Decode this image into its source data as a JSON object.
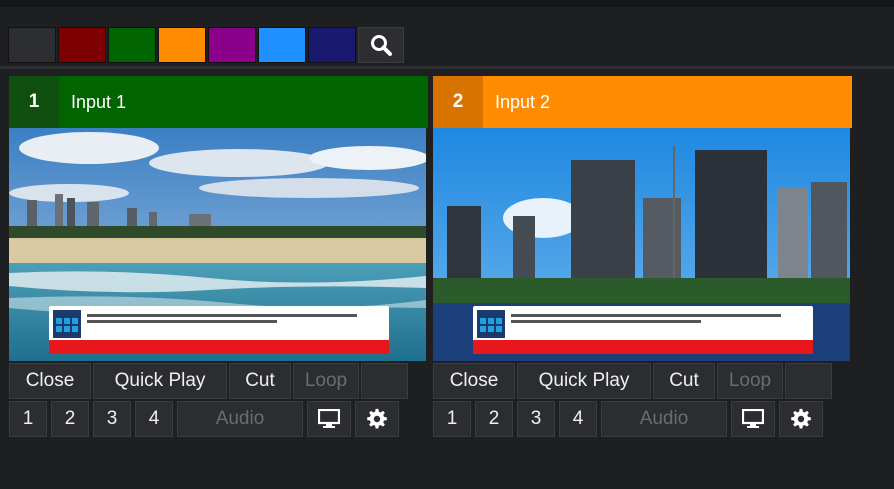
{
  "colors": {
    "swatch_dark": "#2c2e31",
    "swatch_red": "#7f0000",
    "swatch_green": "#006400",
    "swatch_orange": "#ff8c00",
    "swatch_purple": "#8b008b",
    "swatch_blue": "#1e90ff",
    "swatch_navy": "#191970",
    "input1_header": "#006400",
    "input1_number_bg": "#0f4f0f",
    "input2_header": "#ff8c00",
    "input2_number_bg": "#d97300"
  },
  "toolbar": {
    "swatches": [
      "#2c2e31",
      "#7f0000",
      "#006400",
      "#ff8c00",
      "#8b008b",
      "#1e90ff",
      "#191970"
    ],
    "search_icon": "search-icon"
  },
  "inputs": [
    {
      "number": "1",
      "title": "Input 1",
      "buttons": {
        "close": "Close",
        "quick_play": "Quick Play",
        "cut": "Cut",
        "loop": "Loop"
      },
      "layers": [
        "1",
        "2",
        "3",
        "4"
      ],
      "audio": "Audio",
      "monitor_icon": "monitor-icon",
      "settings_icon": "gear-icon"
    },
    {
      "number": "2",
      "title": "Input 2",
      "buttons": {
        "close": "Close",
        "quick_play": "Quick Play",
        "cut": "Cut",
        "loop": "Loop"
      },
      "layers": [
        "1",
        "2",
        "3",
        "4"
      ],
      "audio": "Audio",
      "monitor_icon": "monitor-icon",
      "settings_icon": "gear-icon"
    }
  ]
}
